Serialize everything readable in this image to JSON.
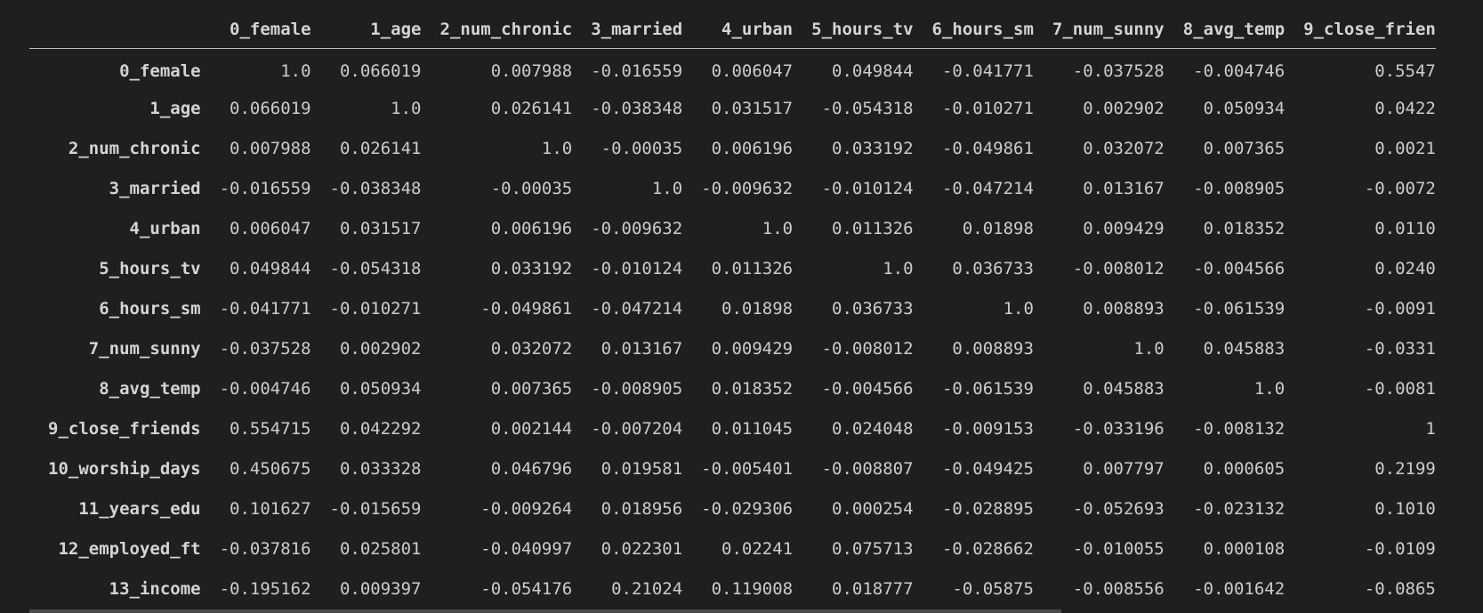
{
  "columns": [
    "",
    "0_female",
    "1_age",
    "2_num_chronic",
    "3_married",
    "4_urban",
    "5_hours_tv",
    "6_hours_sm",
    "7_num_sunny",
    "8_avg_temp",
    "9_close_frien"
  ],
  "rows": [
    {
      "index": "0_female",
      "cells": [
        "1.0",
        "0.066019",
        "0.007988",
        "-0.016559",
        "0.006047",
        "0.049844",
        "-0.041771",
        "-0.037528",
        "-0.004746",
        "0.5547"
      ]
    },
    {
      "index": "1_age",
      "cells": [
        "0.066019",
        "1.0",
        "0.026141",
        "-0.038348",
        "0.031517",
        "-0.054318",
        "-0.010271",
        "0.002902",
        "0.050934",
        "0.0422"
      ]
    },
    {
      "index": "2_num_chronic",
      "cells": [
        "0.007988",
        "0.026141",
        "1.0",
        "-0.00035",
        "0.006196",
        "0.033192",
        "-0.049861",
        "0.032072",
        "0.007365",
        "0.0021"
      ]
    },
    {
      "index": "3_married",
      "cells": [
        "-0.016559",
        "-0.038348",
        "-0.00035",
        "1.0",
        "-0.009632",
        "-0.010124",
        "-0.047214",
        "0.013167",
        "-0.008905",
        "-0.0072"
      ]
    },
    {
      "index": "4_urban",
      "cells": [
        "0.006047",
        "0.031517",
        "0.006196",
        "-0.009632",
        "1.0",
        "0.011326",
        "0.01898",
        "0.009429",
        "0.018352",
        "0.0110"
      ]
    },
    {
      "index": "5_hours_tv",
      "cells": [
        "0.049844",
        "-0.054318",
        "0.033192",
        "-0.010124",
        "0.011326",
        "1.0",
        "0.036733",
        "-0.008012",
        "-0.004566",
        "0.0240"
      ]
    },
    {
      "index": "6_hours_sm",
      "cells": [
        "-0.041771",
        "-0.010271",
        "-0.049861",
        "-0.047214",
        "0.01898",
        "0.036733",
        "1.0",
        "0.008893",
        "-0.061539",
        "-0.0091"
      ]
    },
    {
      "index": "7_num_sunny",
      "cells": [
        "-0.037528",
        "0.002902",
        "0.032072",
        "0.013167",
        "0.009429",
        "-0.008012",
        "0.008893",
        "1.0",
        "0.045883",
        "-0.0331"
      ]
    },
    {
      "index": "8_avg_temp",
      "cells": [
        "-0.004746",
        "0.050934",
        "0.007365",
        "-0.008905",
        "0.018352",
        "-0.004566",
        "-0.061539",
        "0.045883",
        "1.0",
        "-0.0081"
      ]
    },
    {
      "index": "9_close_friends",
      "cells": [
        "0.554715",
        "0.042292",
        "0.002144",
        "-0.007204",
        "0.011045",
        "0.024048",
        "-0.009153",
        "-0.033196",
        "-0.008132",
        "1"
      ]
    },
    {
      "index": "10_worship_days",
      "cells": [
        "0.450675",
        "0.033328",
        "0.046796",
        "0.019581",
        "-0.005401",
        "-0.008807",
        "-0.049425",
        "0.007797",
        "0.000605",
        "0.2199"
      ]
    },
    {
      "index": "11_years_edu",
      "cells": [
        "0.101627",
        "-0.015659",
        "-0.009264",
        "0.018956",
        "-0.029306",
        "0.000254",
        "-0.028895",
        "-0.052693",
        "-0.023132",
        "0.1010"
      ]
    },
    {
      "index": "12_employed_ft",
      "cells": [
        "-0.037816",
        "0.025801",
        "-0.040997",
        "0.022301",
        "0.02241",
        "0.075713",
        "-0.028662",
        "-0.010055",
        "0.000108",
        "-0.0109"
      ]
    },
    {
      "index": "13_income",
      "cells": [
        "-0.195162",
        "0.009397",
        "-0.054176",
        "0.21024",
        "0.119008",
        "0.018777",
        "-0.05875",
        "-0.008556",
        "-0.001642",
        "-0.0865"
      ]
    }
  ]
}
